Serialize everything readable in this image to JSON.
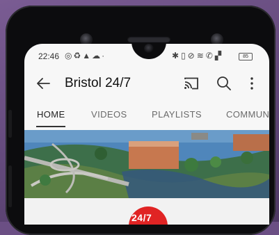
{
  "status_bar": {
    "time": "22:46",
    "left_icons": [
      "whatsapp-icon",
      "recycle-icon",
      "warning-icon",
      "cloud-icon",
      "dot-icon"
    ],
    "right_icons": [
      "bluetooth-icon",
      "vibrate-icon",
      "do-not-disturb-icon",
      "wifi-icon",
      "phone-icon",
      "signal-icon"
    ],
    "battery": "85"
  },
  "app_bar": {
    "title": "Bristol 24/7",
    "icons": [
      "back-arrow-icon",
      "cast-icon",
      "search-icon",
      "more-vert-icon"
    ]
  },
  "tabs": [
    {
      "label": "HOME",
      "active": true
    },
    {
      "label": "VIDEOS",
      "active": false
    },
    {
      "label": "PLAYLISTS",
      "active": false
    },
    {
      "label": "COMMUN",
      "active": false
    }
  ],
  "channel": {
    "avatar_text": "24/7"
  },
  "colors": {
    "avatar_red": "#e02424",
    "tab_active": "#222222",
    "tab_inactive": "#6a6a6a"
  }
}
